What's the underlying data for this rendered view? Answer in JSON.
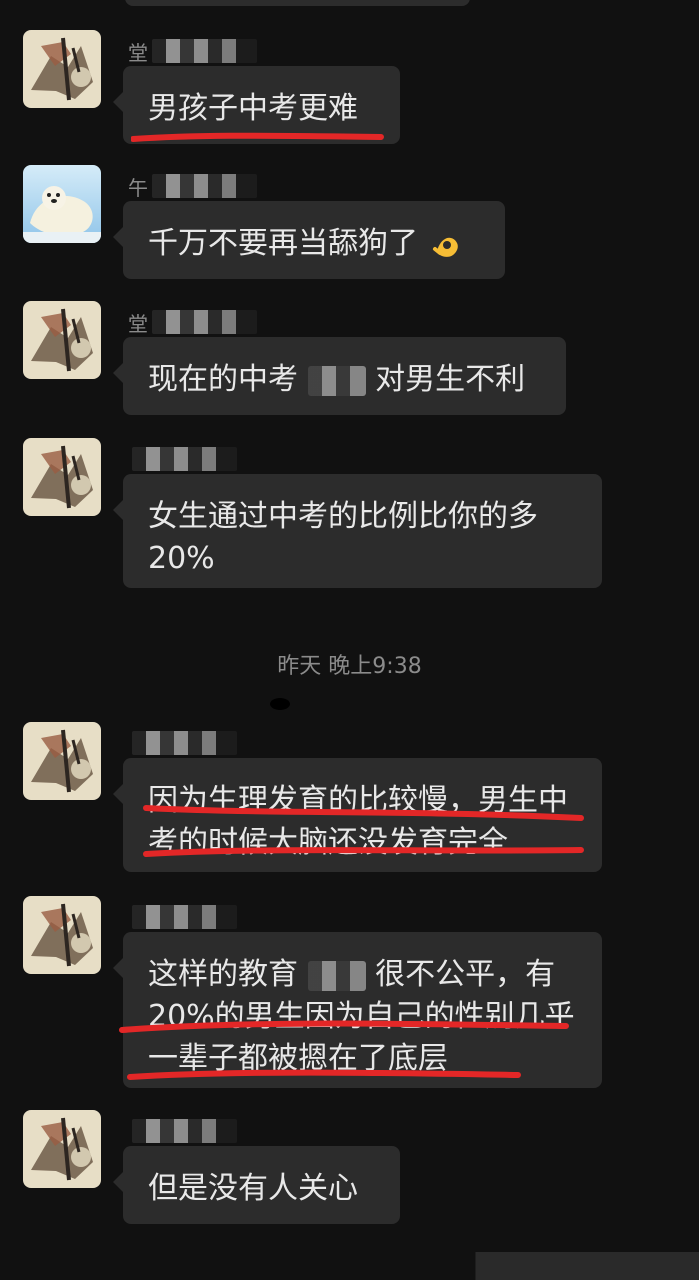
{
  "chat": {
    "time_divider": "昨天 晚上9:38",
    "messages": [
      {
        "sender": "堂",
        "text": "男孩子中考更难",
        "avatar": "ink-horse-avatar"
      },
      {
        "sender": "午",
        "text": "千万不要再当舔狗了",
        "emoji": "ok-hand-icon",
        "avatar": "polar-bear-avatar"
      },
      {
        "sender": "堂",
        "text_before": "现在的中考",
        "text_after": "对男生不利",
        "avatar": "ink-horse-avatar"
      },
      {
        "sender": "",
        "text": "女生通过中考的比例比你的多20%",
        "avatar": "ink-horse-avatar"
      },
      {
        "sender": "",
        "text": "因为生理发育的比较慢，男生中考的时候大脑还没发育完全",
        "avatar": "ink-horse-avatar"
      },
      {
        "sender": "",
        "text_before": "这样的教育",
        "text_after": "很不公平，有20%的男生因为自己的性别几乎一辈子都被摁在了底层",
        "avatar": "ink-horse-avatar"
      },
      {
        "sender": "",
        "text": "但是没有人关心",
        "avatar": "ink-horse-avatar"
      }
    ]
  },
  "colors": {
    "background": "#111111",
    "bubble": "#2c2c2c",
    "text": "#e8e8e8",
    "meta_text": "#8b8b8b",
    "annotation_red": "#e32727"
  }
}
